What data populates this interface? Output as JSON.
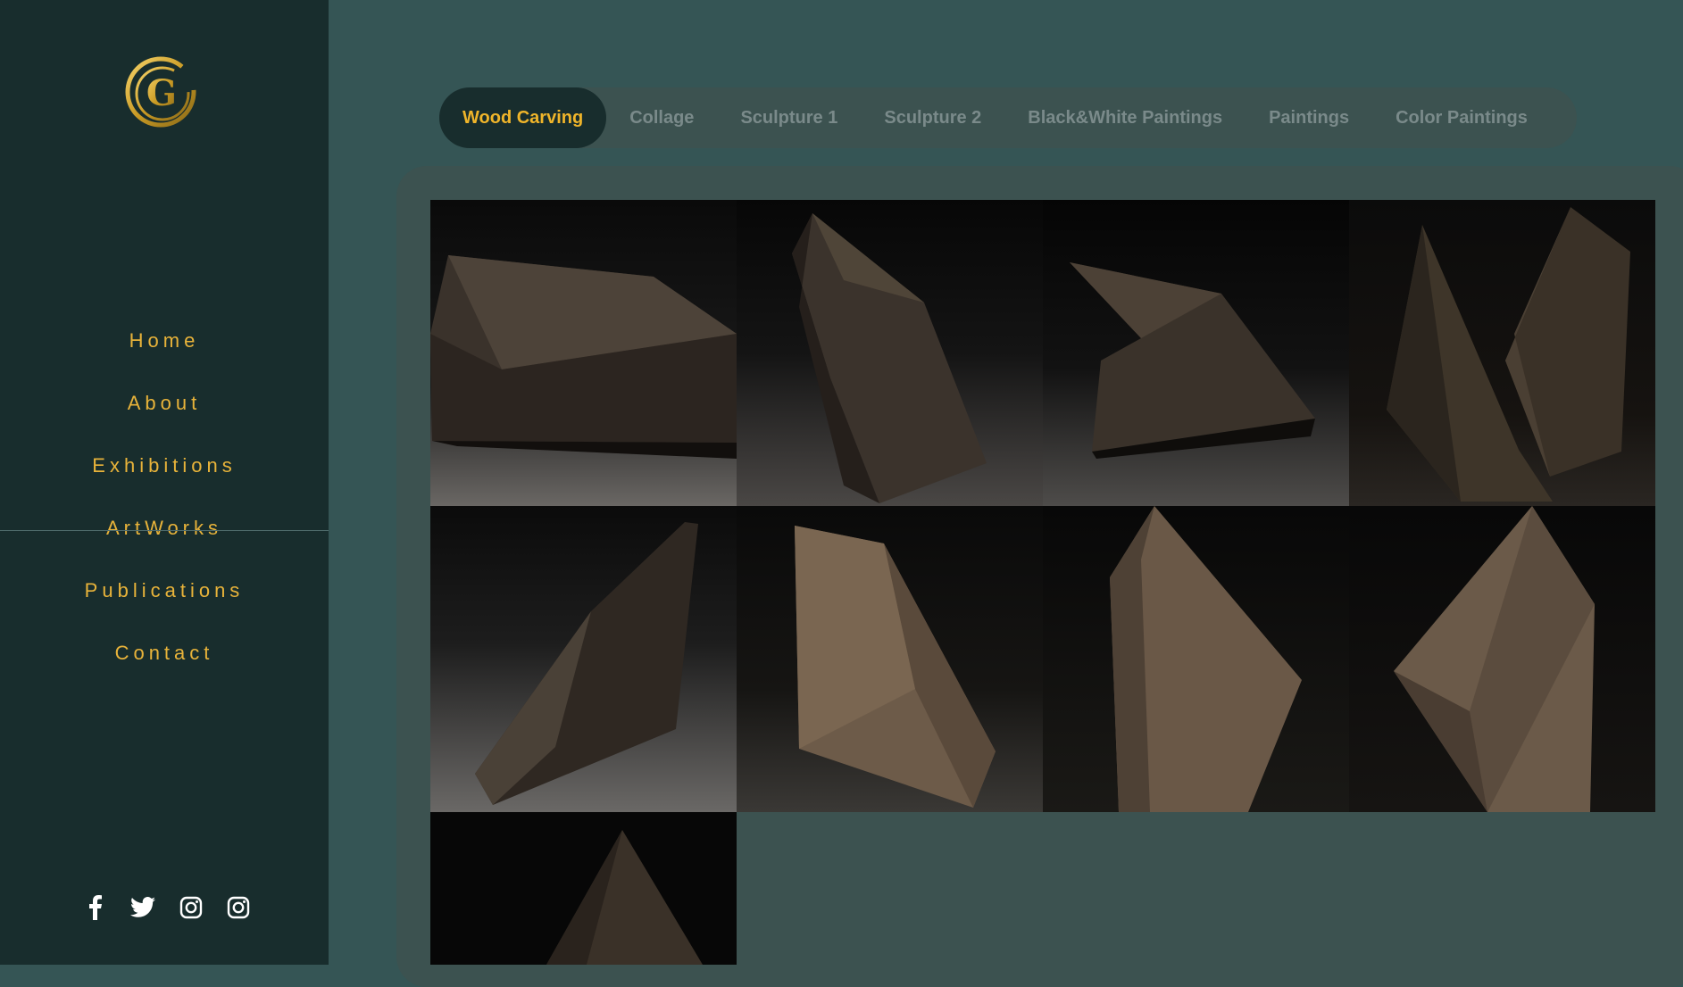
{
  "sidebar": {
    "logo_letter": "G",
    "nav": [
      {
        "label": "Home"
      },
      {
        "label": "About"
      },
      {
        "label": "Exhibitions"
      },
      {
        "label": "ArtWorks"
      },
      {
        "label": "Publications"
      },
      {
        "label": "Contact"
      }
    ],
    "social": [
      {
        "icon": "facebook-icon"
      },
      {
        "icon": "twitter-icon"
      },
      {
        "icon": "instagram-icon"
      },
      {
        "icon": "instagram-icon"
      }
    ]
  },
  "tabs": [
    {
      "label": "Wood Carving",
      "active": true
    },
    {
      "label": "Collage",
      "active": false
    },
    {
      "label": "Sculpture 1",
      "active": false
    },
    {
      "label": "Sculpture 2",
      "active": false
    },
    {
      "label": "Black&White Paintings",
      "active": false
    },
    {
      "label": "Paintings",
      "active": false
    },
    {
      "label": "Color Paintings",
      "active": false
    }
  ],
  "gallery": {
    "category": "Wood Carving",
    "items": [
      {
        "subject": "wood-carving-sculpture-1"
      },
      {
        "subject": "wood-carving-sculpture-2"
      },
      {
        "subject": "wood-carving-sculpture-3"
      },
      {
        "subject": "wood-carving-sculpture-4"
      },
      {
        "subject": "wood-carving-sculpture-5"
      },
      {
        "subject": "wood-carving-sculpture-6"
      },
      {
        "subject": "wood-carving-sculpture-7"
      },
      {
        "subject": "wood-carving-sculpture-8"
      },
      {
        "subject": "wood-carving-sculpture-9"
      }
    ]
  },
  "colors": {
    "sidebar_bg": "#182d2d",
    "page_bg": "#355555",
    "panel_bg": "#3c5250",
    "accent_gold": "#f0b52a",
    "tab_inactive": "#7a8a8a"
  }
}
